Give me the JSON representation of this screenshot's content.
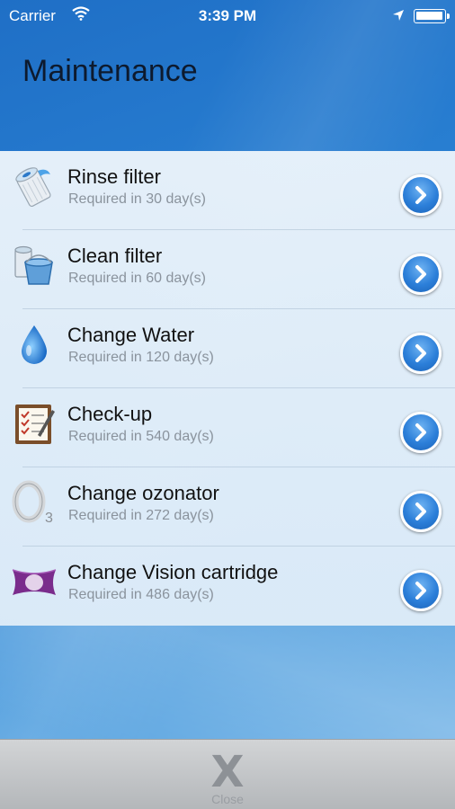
{
  "status_bar": {
    "carrier": "Carrier",
    "time": "3:39 PM",
    "icons": [
      "wifi-icon",
      "location-icon",
      "battery-icon"
    ]
  },
  "header": {
    "title": "Maintenance"
  },
  "maintenance_items": [
    {
      "title": "Rinse filter",
      "subtitle": "Required in 30 day(s)",
      "icon": "filter-cartridge-icon"
    },
    {
      "title": "Clean filter",
      "subtitle": "Required in 60 day(s)",
      "icon": "bucket-icon"
    },
    {
      "title": "Change Water",
      "subtitle": "Required in 120 day(s)",
      "icon": "water-drop-icon"
    },
    {
      "title": "Check-up",
      "subtitle": "Required in 540 day(s)",
      "icon": "checklist-icon"
    },
    {
      "title": "Change ozonator",
      "subtitle": "Required in 272 day(s)",
      "icon": "ozone-o3-icon"
    },
    {
      "title": "Change Vision cartridge",
      "subtitle": "Required in 486 day(s)",
      "icon": "vision-cartridge-icon"
    }
  ],
  "toolbar": {
    "close_label": "Close",
    "close_glyph": "X"
  },
  "colors": {
    "background": "#2a82d4",
    "disclosure": "#2c7fd9",
    "vision_purple": "#7a2c8c"
  }
}
